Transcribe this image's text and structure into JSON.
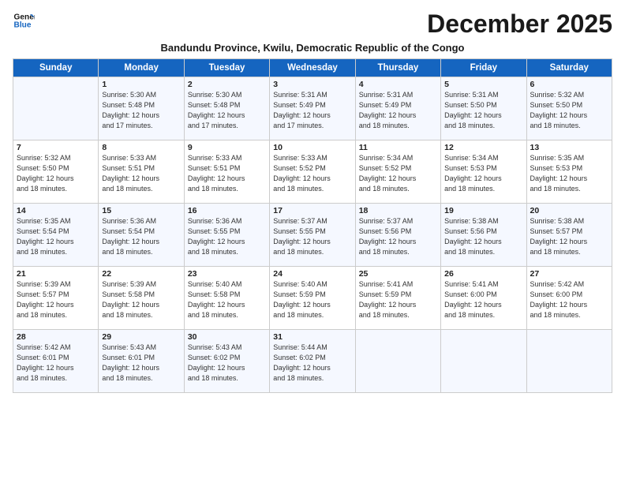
{
  "header": {
    "logo_line1": "General",
    "logo_line2": "Blue",
    "month": "December 2025",
    "subtitle": "Bandundu Province, Kwilu, Democratic Republic of the Congo"
  },
  "days_of_week": [
    "Sunday",
    "Monday",
    "Tuesday",
    "Wednesday",
    "Thursday",
    "Friday",
    "Saturday"
  ],
  "weeks": [
    [
      {
        "num": "",
        "info": ""
      },
      {
        "num": "1",
        "info": "Sunrise: 5:30 AM\nSunset: 5:48 PM\nDaylight: 12 hours\nand 17 minutes."
      },
      {
        "num": "2",
        "info": "Sunrise: 5:30 AM\nSunset: 5:48 PM\nDaylight: 12 hours\nand 17 minutes."
      },
      {
        "num": "3",
        "info": "Sunrise: 5:31 AM\nSunset: 5:49 PM\nDaylight: 12 hours\nand 17 minutes."
      },
      {
        "num": "4",
        "info": "Sunrise: 5:31 AM\nSunset: 5:49 PM\nDaylight: 12 hours\nand 18 minutes."
      },
      {
        "num": "5",
        "info": "Sunrise: 5:31 AM\nSunset: 5:50 PM\nDaylight: 12 hours\nand 18 minutes."
      },
      {
        "num": "6",
        "info": "Sunrise: 5:32 AM\nSunset: 5:50 PM\nDaylight: 12 hours\nand 18 minutes."
      }
    ],
    [
      {
        "num": "7",
        "info": "Sunrise: 5:32 AM\nSunset: 5:50 PM\nDaylight: 12 hours\nand 18 minutes."
      },
      {
        "num": "8",
        "info": "Sunrise: 5:33 AM\nSunset: 5:51 PM\nDaylight: 12 hours\nand 18 minutes."
      },
      {
        "num": "9",
        "info": "Sunrise: 5:33 AM\nSunset: 5:51 PM\nDaylight: 12 hours\nand 18 minutes."
      },
      {
        "num": "10",
        "info": "Sunrise: 5:33 AM\nSunset: 5:52 PM\nDaylight: 12 hours\nand 18 minutes."
      },
      {
        "num": "11",
        "info": "Sunrise: 5:34 AM\nSunset: 5:52 PM\nDaylight: 12 hours\nand 18 minutes."
      },
      {
        "num": "12",
        "info": "Sunrise: 5:34 AM\nSunset: 5:53 PM\nDaylight: 12 hours\nand 18 minutes."
      },
      {
        "num": "13",
        "info": "Sunrise: 5:35 AM\nSunset: 5:53 PM\nDaylight: 12 hours\nand 18 minutes."
      }
    ],
    [
      {
        "num": "14",
        "info": "Sunrise: 5:35 AM\nSunset: 5:54 PM\nDaylight: 12 hours\nand 18 minutes."
      },
      {
        "num": "15",
        "info": "Sunrise: 5:36 AM\nSunset: 5:54 PM\nDaylight: 12 hours\nand 18 minutes."
      },
      {
        "num": "16",
        "info": "Sunrise: 5:36 AM\nSunset: 5:55 PM\nDaylight: 12 hours\nand 18 minutes."
      },
      {
        "num": "17",
        "info": "Sunrise: 5:37 AM\nSunset: 5:55 PM\nDaylight: 12 hours\nand 18 minutes."
      },
      {
        "num": "18",
        "info": "Sunrise: 5:37 AM\nSunset: 5:56 PM\nDaylight: 12 hours\nand 18 minutes."
      },
      {
        "num": "19",
        "info": "Sunrise: 5:38 AM\nSunset: 5:56 PM\nDaylight: 12 hours\nand 18 minutes."
      },
      {
        "num": "20",
        "info": "Sunrise: 5:38 AM\nSunset: 5:57 PM\nDaylight: 12 hours\nand 18 minutes."
      }
    ],
    [
      {
        "num": "21",
        "info": "Sunrise: 5:39 AM\nSunset: 5:57 PM\nDaylight: 12 hours\nand 18 minutes."
      },
      {
        "num": "22",
        "info": "Sunrise: 5:39 AM\nSunset: 5:58 PM\nDaylight: 12 hours\nand 18 minutes."
      },
      {
        "num": "23",
        "info": "Sunrise: 5:40 AM\nSunset: 5:58 PM\nDaylight: 12 hours\nand 18 minutes."
      },
      {
        "num": "24",
        "info": "Sunrise: 5:40 AM\nSunset: 5:59 PM\nDaylight: 12 hours\nand 18 minutes."
      },
      {
        "num": "25",
        "info": "Sunrise: 5:41 AM\nSunset: 5:59 PM\nDaylight: 12 hours\nand 18 minutes."
      },
      {
        "num": "26",
        "info": "Sunrise: 5:41 AM\nSunset: 6:00 PM\nDaylight: 12 hours\nand 18 minutes."
      },
      {
        "num": "27",
        "info": "Sunrise: 5:42 AM\nSunset: 6:00 PM\nDaylight: 12 hours\nand 18 minutes."
      }
    ],
    [
      {
        "num": "28",
        "info": "Sunrise: 5:42 AM\nSunset: 6:01 PM\nDaylight: 12 hours\nand 18 minutes."
      },
      {
        "num": "29",
        "info": "Sunrise: 5:43 AM\nSunset: 6:01 PM\nDaylight: 12 hours\nand 18 minutes."
      },
      {
        "num": "30",
        "info": "Sunrise: 5:43 AM\nSunset: 6:02 PM\nDaylight: 12 hours\nand 18 minutes."
      },
      {
        "num": "31",
        "info": "Sunrise: 5:44 AM\nSunset: 6:02 PM\nDaylight: 12 hours\nand 18 minutes."
      },
      {
        "num": "",
        "info": ""
      },
      {
        "num": "",
        "info": ""
      },
      {
        "num": "",
        "info": ""
      }
    ]
  ]
}
